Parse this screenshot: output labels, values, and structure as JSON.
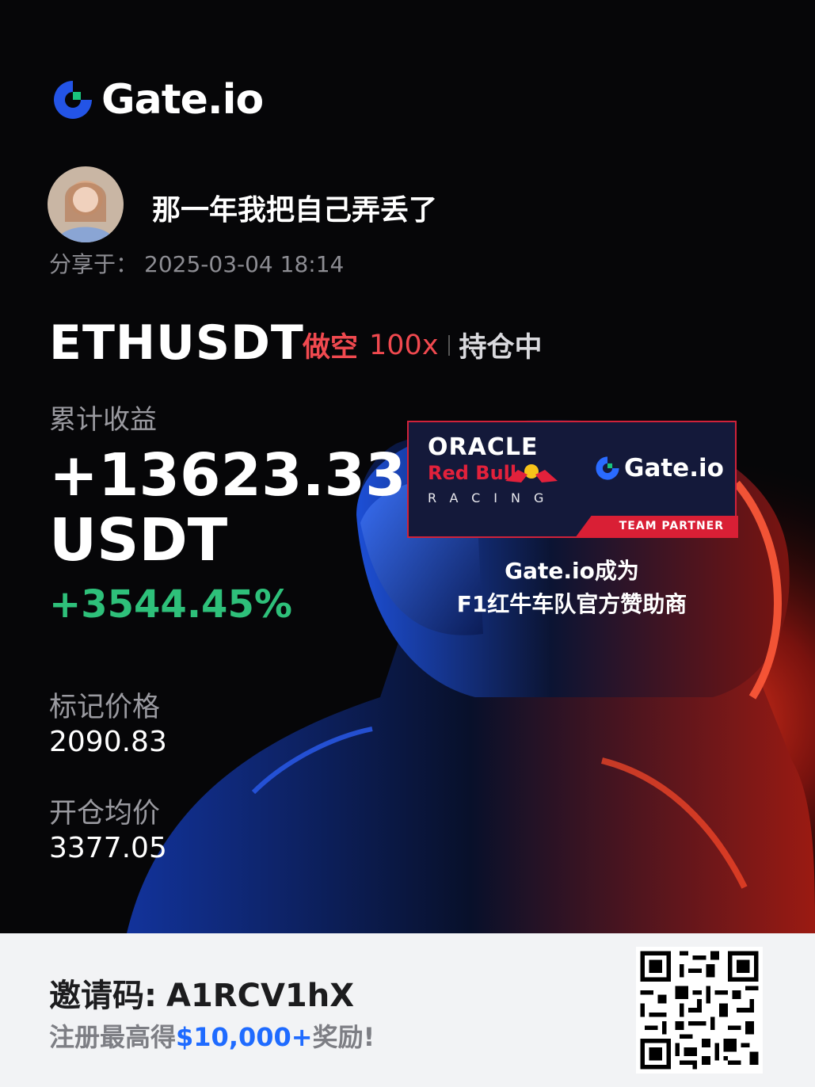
{
  "brand": {
    "logo_text": "Gate.io",
    "accent": "#2354e6",
    "accent_green": "#19c37d"
  },
  "user": {
    "name": "那一年我把自己弄丢了",
    "share_label": "分享于：",
    "share_time": "2025-03-04 18:14"
  },
  "position": {
    "pair": "ETHUSDT",
    "direction": "做空",
    "leverage": "100x",
    "status": "持仓中"
  },
  "pnl": {
    "label": "累计收益",
    "amount": "+13623.33",
    "currency": "USDT",
    "percent": "+3544.45%"
  },
  "mark_price": {
    "label": "标记价格",
    "value": "2090.83"
  },
  "entry_price": {
    "label": "开仓均价",
    "value": "3377.05"
  },
  "banner": {
    "oracle": "ORACLE",
    "redbull": "Red Bull",
    "racing": "RACING",
    "logo_text": "Gate.io",
    "partner": "TEAM PARTNER"
  },
  "caption": {
    "line1": "Gate.io成为",
    "line2": "F1红牛车队官方赞助商"
  },
  "footer": {
    "invite_label": "邀请码:",
    "invite_code": "A1RCV1hX",
    "reward_prefix": "注册最高得",
    "reward_amount": "$10,000+",
    "reward_suffix": "奖励!"
  },
  "colors": {
    "short": "#f0494f",
    "profit": "#2ec07a",
    "link": "#1f6bff"
  }
}
